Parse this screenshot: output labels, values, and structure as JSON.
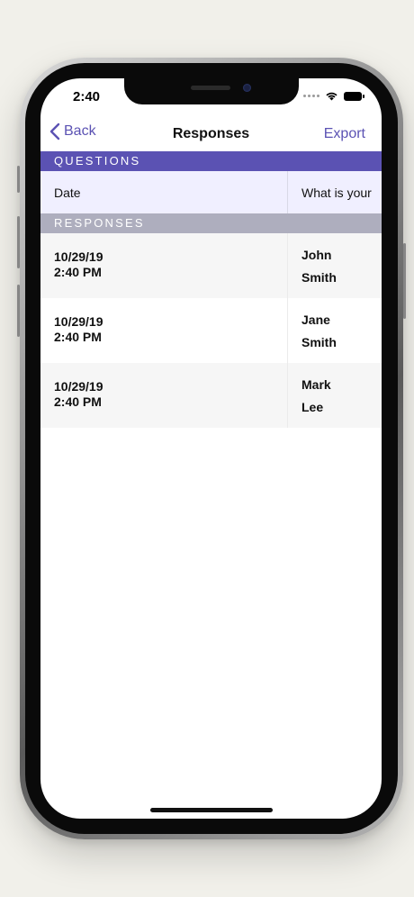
{
  "status_bar": {
    "time": "2:40"
  },
  "nav": {
    "back_label": "Back",
    "title": "Responses",
    "export_label": "Export"
  },
  "sections": {
    "questions_header": "QUESTIONS",
    "responses_header": "RESPONSES"
  },
  "questions": {
    "columns": [
      "Date",
      "What is your"
    ]
  },
  "responses": [
    {
      "date": "10/29/19",
      "time": "2:40 PM",
      "first": "John",
      "last": "Smith"
    },
    {
      "date": "10/29/19",
      "time": "2:40 PM",
      "first": "Jane",
      "last": "Smith"
    },
    {
      "date": "10/29/19",
      "time": "2:40 PM",
      "first": "Mark",
      "last": "Lee"
    }
  ],
  "colors": {
    "accent": "#5b52b3",
    "questions_header_bg": "#5b52b3",
    "responses_header_bg": "#aeaebe",
    "question_row_bg": "#f0efff"
  },
  "icons": {
    "back": "chevron-left-icon",
    "wifi": "wifi-icon",
    "battery": "battery-icon",
    "signal": "signal-icon"
  }
}
